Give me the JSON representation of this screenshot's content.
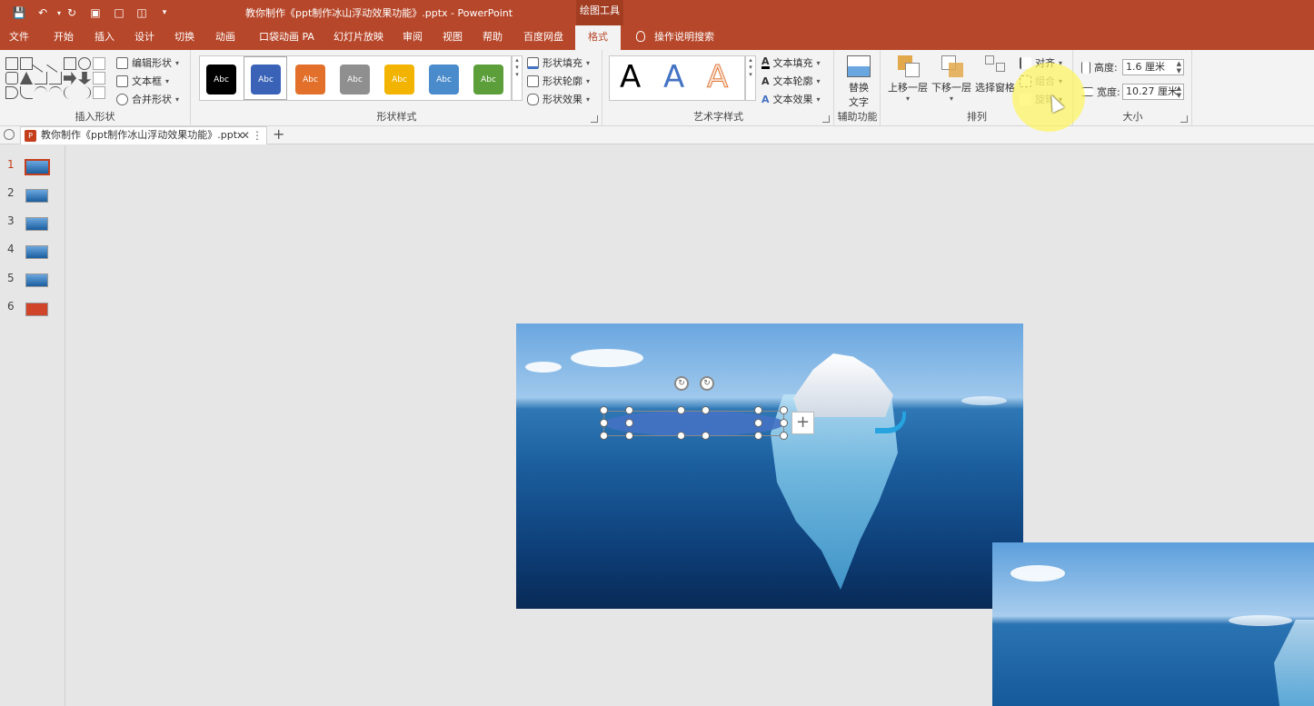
{
  "window": {
    "title": "教你制作《ppt制作冰山浮动效果功能》.pptx  -  PowerPoint",
    "context_tab": "绘图工具"
  },
  "ribbon_tabs": [
    "文件",
    "开始",
    "插入",
    "设计",
    "切换",
    "动画",
    "口袋动画 PA",
    "幻灯片放映",
    "审阅",
    "视图",
    "帮助",
    "百度网盘",
    "格式"
  ],
  "search_tab": "操作说明搜索",
  "groups": {
    "insert_shapes": {
      "label": "插入形状",
      "edit_shape": "编辑形状",
      "text_box": "文本框",
      "merge_shapes": "合并形状"
    },
    "shape_styles": {
      "label": "形状样式",
      "swatch_text": "Abc",
      "swatches": [
        "#000000",
        "#3a63b8",
        "#e2702b",
        "#8f8f8f",
        "#f2b400",
        "#4a8bcc",
        "#5c9e3a"
      ],
      "fill": "形状填充",
      "outline": "形状轮廓",
      "effects": "形状效果"
    },
    "wordart": {
      "label": "艺术字样式",
      "glyph": "A",
      "fill": "文本填充",
      "outline": "文本轮廓",
      "effects": "文本效果"
    },
    "accessibility": {
      "label": "辅助功能",
      "alt_text_l1": "替换",
      "alt_text_l2": "文字"
    },
    "arrange": {
      "label": "排列",
      "bring_forward": "上移一层",
      "send_backward": "下移一层",
      "selection_pane": "选择窗格",
      "align": "对齐",
      "group": "组合",
      "rotate": "旋转"
    },
    "size": {
      "label": "大小",
      "height_label": "高度:",
      "height_value": "1.6 厘米",
      "width_label": "宽度:",
      "width_value": "10.27 厘米"
    }
  },
  "doc_tab": {
    "name": "教你制作《ppt制作冰山浮动效果功能》.pptx"
  },
  "slides": [
    "1",
    "2",
    "3",
    "4",
    "5",
    "6"
  ],
  "colors": {
    "accent": "#b7472a",
    "ellipse": "#4472c4",
    "ring": "#27a3e0"
  }
}
